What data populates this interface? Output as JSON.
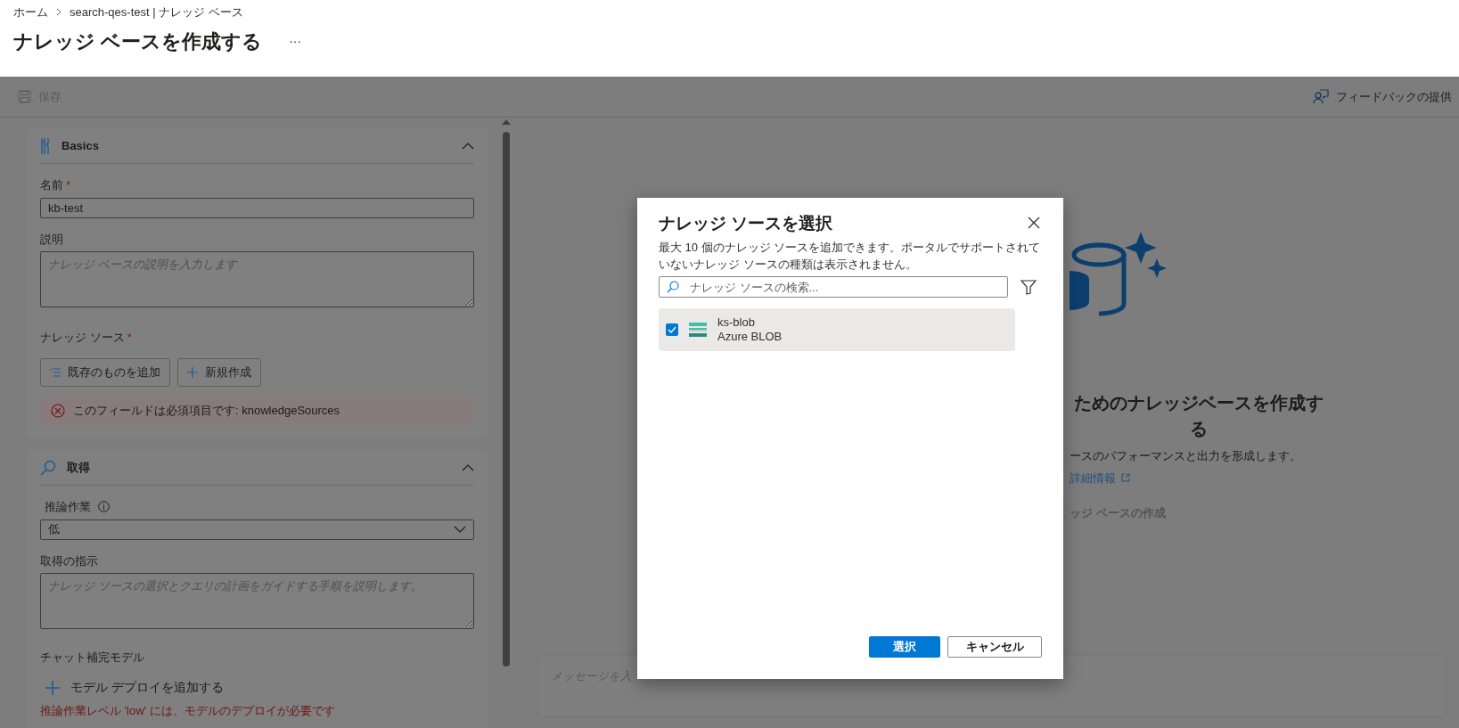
{
  "breadcrumb": [
    {
      "label": "ホーム"
    },
    {
      "label": "search-qes-test | ナレッジ ベース"
    }
  ],
  "page_title": "ナレッジ ベースを作成する",
  "more_menu": "···",
  "required_marker": "*",
  "toolbar": {
    "save": {
      "label": "保存",
      "disabled": true
    },
    "feedback": "フィードバックの提供"
  },
  "basics": {
    "title": "Basics",
    "expanded": true,
    "name_label": "名前",
    "name_required": true,
    "name_value": "kb-test",
    "description_label": "説明",
    "description_placeholder": "ナレッジ ベースの説明を入力します",
    "sources_label": "ナレッジ ソース",
    "sources_required": true,
    "buttons": [
      {
        "label": "既存のものを追加",
        "kind": "list"
      },
      {
        "label": "新規作成",
        "kind": "add"
      }
    ],
    "error": "このフィールドは必須項目です: knowledgeSources"
  },
  "retrieval": {
    "title": "取得",
    "expanded": true,
    "effort_label": "推論作業",
    "effort_value": "低",
    "instructions_label": "取得の指示",
    "instructions_placeholder": "ナレッジ ソースの選択とクエリの計画をガイドする手順を説明します。",
    "model_label": "チャット補完モデル",
    "add_model": "モデル デプロイを追加する",
    "warning": "推論作業レベル 'low' には、モデルのデプロイが必要です"
  },
  "empty_state": {
    "heading": "ためのナレッジベースを作成する",
    "subtitle": "ースのパフォーマンスと出力を形成します。",
    "learn_more": "詳細情報",
    "create": "ッジ ベースの作成"
  },
  "chat": {
    "placeholder": "メッセージを入"
  },
  "dialog": {
    "title": "ナレッジ ソースを選択",
    "description": "最大 10 個のナレッジ ソースを追加できます。ポータルでサポートされていないナレッジ ソースの種類は表示されません。",
    "search_placeholder": "ナレッジ ソースの検索...",
    "sources": [
      {
        "name": "ks-blob",
        "type": "Azure BLOB",
        "checked": true
      }
    ],
    "buttons": [
      {
        "label": "選択",
        "kind": "primary"
      },
      {
        "label": "キャンセル",
        "kind": "secondary"
      }
    ]
  }
}
